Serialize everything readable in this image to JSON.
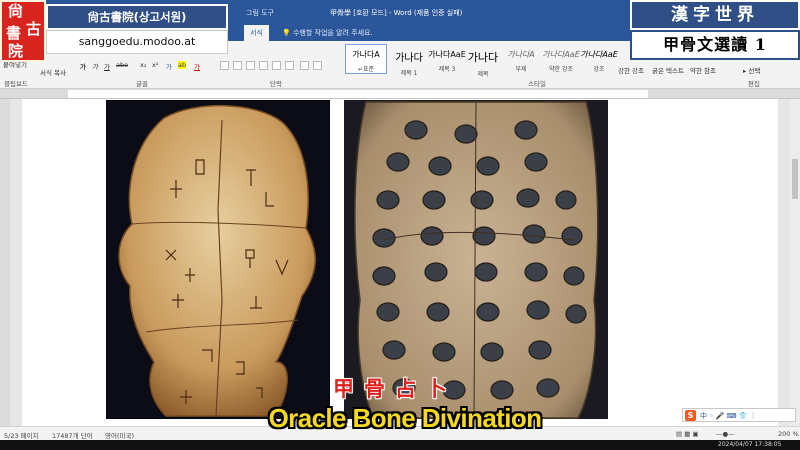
{
  "word": {
    "contextual_tab": "그림 도구",
    "doc_title": "甲骨學 [호환 모드] - Word (제품 인증 실패)",
    "tabs": [
      "서식"
    ],
    "tell_me": "수행할 작업을 알려 주세요.",
    "clipboard": {
      "paste_label": "붙여넣기",
      "format_painter": "서식 복사",
      "group_label": "클립보드"
    },
    "groups": {
      "font": "글꼴",
      "paragraph": "단락",
      "styles": "스타일",
      "editing": "편집"
    },
    "styles": [
      {
        "sample": "가나다A",
        "name": "↵표준"
      },
      {
        "sample": "가나다",
        "name": "제목 1"
      },
      {
        "sample": "가나다AaE",
        "name": "제목 3"
      },
      {
        "sample": "가나다",
        "name": "제목"
      },
      {
        "sample": "가나다A",
        "name": "부제"
      },
      {
        "sample": "가나다AaE",
        "name": "약한 강조"
      },
      {
        "sample": "가나다AaE",
        "name": "강조"
      },
      {
        "sample": "",
        "name": "강한 강조"
      },
      {
        "sample": "",
        "name": "굵은 텍스트"
      },
      {
        "sample": "",
        "name": "약한 참조"
      }
    ],
    "select_label": "선택",
    "status": {
      "page": "5/23 페이지",
      "words": "17487개 단어",
      "language": "영어(미국)",
      "zoom": "200 %"
    },
    "selected_style_index": 0
  },
  "overlay": {
    "logo_chars": [
      "尙",
      "古",
      "書",
      "院"
    ],
    "channel_name": "尙古書院(상고서원)",
    "channel_url": "sanggoedu.modoo.at",
    "series_title": "漢字世界",
    "series_episode": "甲骨文選讀 1",
    "subtitle_han": "甲骨占卜",
    "subtitle_en": "Oracle Bone Divination",
    "timestamp": "2024/04/07 17:38:05"
  },
  "colors": {
    "word_blue": "#2b579a",
    "channel_blue": "#2f4f86",
    "seal_red": "#d7241e",
    "subtitle_red": "#e0201c",
    "subtitle_yellow": "#f5d923"
  },
  "images": {
    "left": "turtle-plastron-inscribed",
    "right": "turtle-shell-drilled-hollows"
  }
}
